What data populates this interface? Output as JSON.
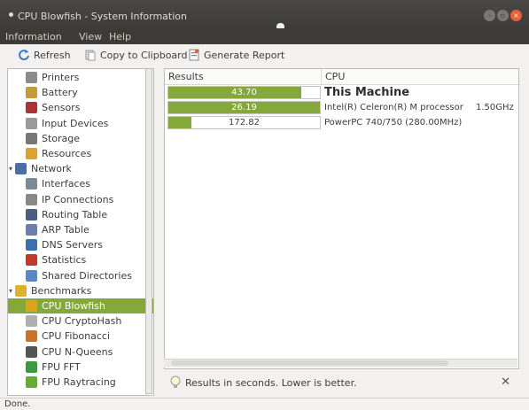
{
  "window": {
    "title": "CPU Blowfish - System Information"
  },
  "menu": [
    "Information",
    "View",
    "Help"
  ],
  "toolbar": {
    "refresh_label": "Refresh",
    "copy_label": "Copy to Clipboard",
    "report_label": "Generate Report"
  },
  "sidebar": {
    "items": [
      {
        "label": "Printers",
        "icon": "printer-icon",
        "color": "#8b8b8b",
        "indent": 1
      },
      {
        "label": "Battery",
        "icon": "battery-icon",
        "color": "#c49a3a",
        "indent": 1
      },
      {
        "label": "Sensors",
        "icon": "thermometer-icon",
        "color": "#a33",
        "indent": 1
      },
      {
        "label": "Input Devices",
        "icon": "keyboard-icon",
        "color": "#9a9a9a",
        "indent": 1
      },
      {
        "label": "Storage",
        "icon": "disk-icon",
        "color": "#777",
        "indent": 1
      },
      {
        "label": "Resources",
        "icon": "resources-icon",
        "color": "#e0a030",
        "indent": 1
      },
      {
        "label": "Network",
        "icon": "network-icon",
        "color": "#4a6fa5",
        "indent": 0,
        "expander": "▾"
      },
      {
        "label": "Interfaces",
        "icon": "interfaces-icon",
        "color": "#7a8a9a",
        "indent": 1
      },
      {
        "label": "IP Connections",
        "icon": "ip-connections-icon",
        "color": "#888",
        "indent": 1
      },
      {
        "label": "Routing Table",
        "icon": "routing-table-icon",
        "color": "#4a5f80",
        "indent": 1
      },
      {
        "label": "ARP Table",
        "icon": "arp-table-icon",
        "color": "#6a7fb0",
        "indent": 1
      },
      {
        "label": "DNS Servers",
        "icon": "dns-servers-icon",
        "color": "#3a6fb0",
        "indent": 1
      },
      {
        "label": "Statistics",
        "icon": "statistics-icon",
        "color": "#c0392b",
        "indent": 1
      },
      {
        "label": "Shared Directories",
        "icon": "shared-directories-icon",
        "color": "#5a88c0",
        "indent": 1
      },
      {
        "label": "Benchmarks",
        "icon": "benchmarks-icon",
        "color": "#e0b030",
        "indent": 0,
        "expander": "▾"
      },
      {
        "label": "CPU Blowfish",
        "icon": "cpu-blowfish-icon",
        "color": "#e0a020",
        "indent": 1,
        "selected": true
      },
      {
        "label": "CPU CryptoHash",
        "icon": "cpu-cryptohash-icon",
        "color": "#b0b0b0",
        "indent": 1
      },
      {
        "label": "CPU Fibonacci",
        "icon": "cpu-fibonacci-icon",
        "color": "#d07020",
        "indent": 1
      },
      {
        "label": "CPU N-Queens",
        "icon": "cpu-nqueens-icon",
        "color": "#555",
        "indent": 1
      },
      {
        "label": "FPU FFT",
        "icon": "fpu-fft-icon",
        "color": "#3a9a40",
        "indent": 1
      },
      {
        "label": "FPU Raytracing",
        "icon": "fpu-raytracing-icon",
        "color": "#6aaa30",
        "indent": 1
      }
    ]
  },
  "results": {
    "columns": [
      "Results",
      "CPU"
    ],
    "rows": [
      {
        "value": "43.70",
        "fraction": 0.88,
        "cpu": "This Machine",
        "freq": "",
        "highlight": true
      },
      {
        "value": "26.19",
        "fraction": 1.0,
        "cpu": "Intel(R) Celeron(R) M processor",
        "freq": "1.50GHz",
        "highlight": false
      },
      {
        "value": "172.82",
        "fraction": 0.15,
        "cpu": "PowerPC 740/750 (280.00MHz)",
        "freq": "",
        "highlight": false
      }
    ]
  },
  "note": {
    "text": "Results in seconds. Lower is better.",
    "close_glyph": "✕"
  },
  "status": {
    "text": "Done."
  },
  "colors": {
    "accent": "#84a83a",
    "title_bg": "#3c3b37",
    "ubuntu_orange": "#e0541f"
  }
}
